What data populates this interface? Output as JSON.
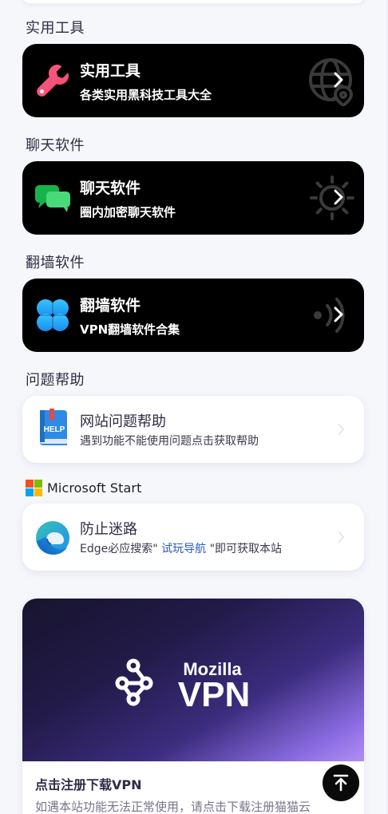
{
  "sections": {
    "tools": {
      "heading": "实用工具",
      "card": {
        "title": "实用工具",
        "subtitle": "各类实用黑科技工具大全",
        "icon": "wrench-icon",
        "deco": "globe-pin-icon"
      }
    },
    "chat": {
      "heading": "聊天软件",
      "card": {
        "title": "聊天软件",
        "subtitle": "圈内加密聊天软件",
        "icon": "chat-bubbles-icon",
        "deco": "sun-icon"
      }
    },
    "vpn": {
      "heading": "翻墙软件",
      "card": {
        "title": "翻墙软件",
        "subtitle": "VPN翻墙软件合集",
        "icon": "clover-icon",
        "deco": "signal-waves-icon"
      }
    },
    "help": {
      "heading": "问题帮助",
      "card": {
        "title": "网站问题帮助",
        "subtitle": "遇到功能不能使用问题点击获取帮助",
        "icon": "help-book-icon",
        "book_label": "HELP"
      }
    },
    "microsoft": {
      "brand": "Microsoft Start",
      "card": {
        "title": "防止迷路",
        "subtitle_prefix": "Edge必应搜索\"",
        "subtitle_link": "试玩导航",
        "subtitle_suffix": "\"即可获取本站",
        "icon": "edge-icon"
      }
    }
  },
  "promo": {
    "brand_top": "Mozilla",
    "brand_bottom": "VPN",
    "title": "点击注册下载VPN",
    "description": "如遇本站功能无法正常使用，请点击下载注册猫猫云"
  },
  "colors": {
    "page_bg": "#f6f7fb",
    "card_dark": "#000000",
    "link": "#2a5bbd",
    "ms_red": "#f25022",
    "ms_green": "#7fba00",
    "ms_blue": "#00a4ef",
    "ms_yellow": "#ffb900"
  },
  "back_to_top": {
    "icon": "arrow-up-to-line-icon"
  }
}
